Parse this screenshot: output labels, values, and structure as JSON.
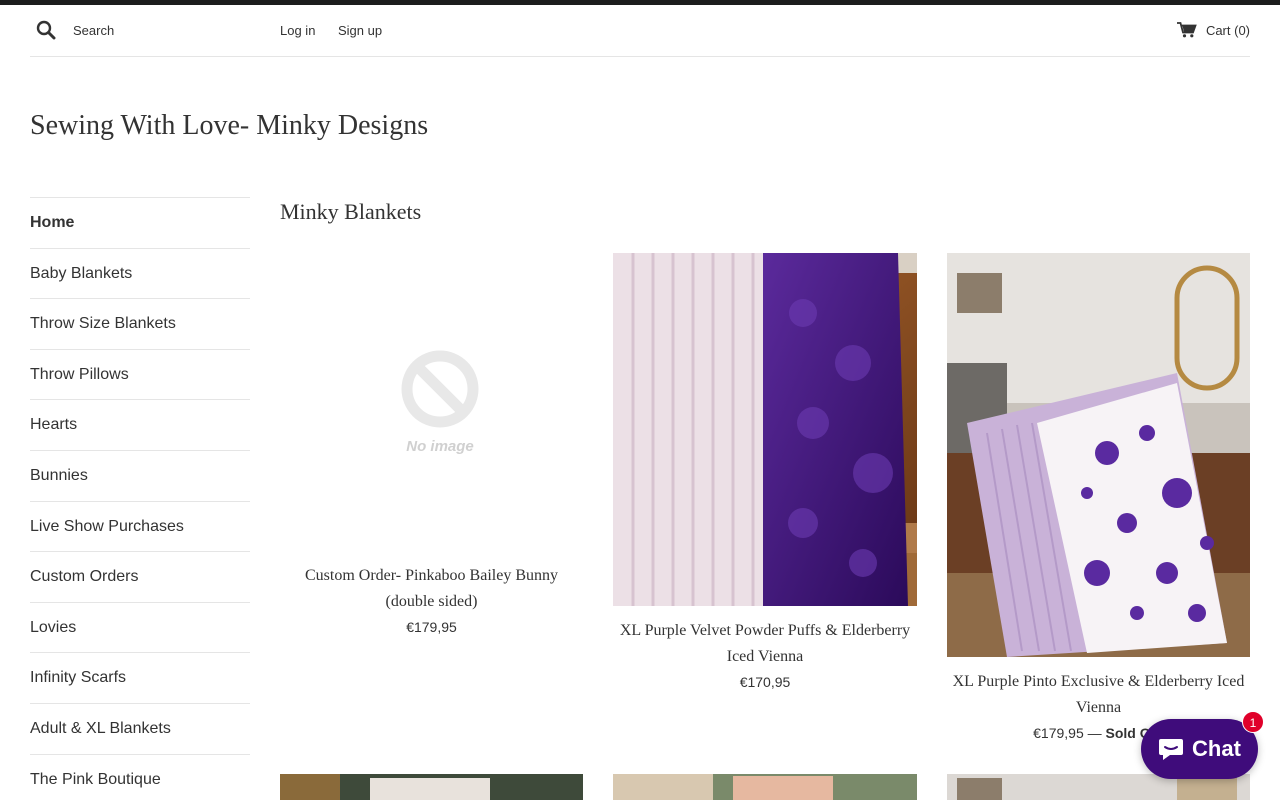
{
  "header": {
    "search_label": "Search",
    "search_placeholder": "Search",
    "login": "Log in",
    "signup": "Sign up",
    "cart_label": "Cart (0)"
  },
  "site": {
    "title": "Sewing With Love- Minky Designs"
  },
  "sidebar": {
    "items": [
      {
        "label": "Home",
        "active": true
      },
      {
        "label": "Baby Blankets"
      },
      {
        "label": "Throw Size Blankets"
      },
      {
        "label": "Throw Pillows"
      },
      {
        "label": "Hearts"
      },
      {
        "label": "Bunnies"
      },
      {
        "label": "Live Show Purchases"
      },
      {
        "label": "Custom Orders"
      },
      {
        "label": "Lovies"
      },
      {
        "label": "Infinity Scarfs"
      },
      {
        "label": "Adult & XL Blankets"
      },
      {
        "label": "The Pink Boutique"
      }
    ]
  },
  "collection": {
    "title": "Minky Blankets",
    "products": [
      {
        "title": "Custom Order- Pinkaboo Bailey Bunny (double sided)",
        "price": "€179,95",
        "image": "no-image",
        "no_image_text": "No image"
      },
      {
        "title": "XL Purple Velvet Powder Puffs & Elderberry Iced Vienna",
        "price": "€170,95",
        "image": "purple-white-blanket"
      },
      {
        "title": "XL Purple Pinto Exclusive & Elderberry Iced Vienna",
        "price": "€179,95",
        "sold_out_sep": "—",
        "sold_out": "Sold Out",
        "image": "purple-pinto-blanket"
      }
    ]
  },
  "chat": {
    "label": "Chat",
    "badge": "1"
  },
  "colors": {
    "accent": "#3f0c7b",
    "badge": "#e0002a",
    "text": "#333333"
  }
}
